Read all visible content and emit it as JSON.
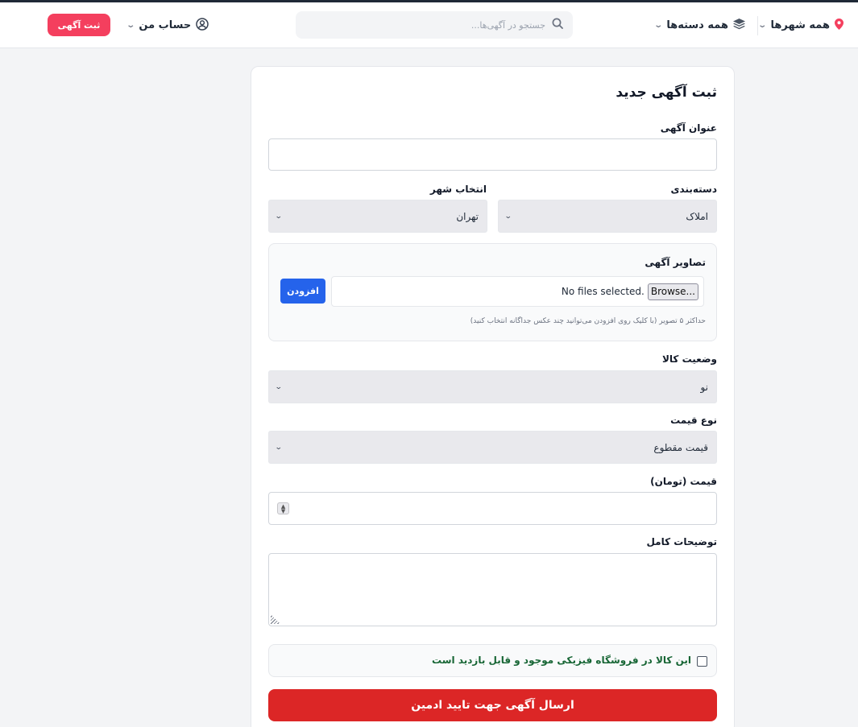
{
  "header": {
    "city_label": "همه شهرها",
    "categories_label": "همه دسته‌ها",
    "search_placeholder": "جستجو در آگهی‌ها...",
    "account_label": "حساب من",
    "post_ad_label": "ثبت آگهی",
    "accent_color": "#f43f5e"
  },
  "form": {
    "title": "ثبت آگهی جدید",
    "ad_title_label": "عنوان آگهی",
    "ad_title_value": "",
    "category_label": "دسته‌بندی",
    "category_value": "املاک",
    "city_label": "انتخاب شهر",
    "city_value": "تهران",
    "images_label": "تصاویر آگهی",
    "browse_label": "Browse...",
    "no_files_label": "No files selected.",
    "add_label": "افزودن",
    "images_hint": "حداکثر ۵ تصویر (با کلیک روی افزودن می‌توانید چند عکس جداگانه انتخاب کنید)",
    "condition_label": "وضعیت کالا",
    "condition_value": "نو",
    "price_type_label": "نوع قیمت",
    "price_type_value": "قیمت مقطوع",
    "price_label": "قیمت (تومان)",
    "price_value": "",
    "description_label": "توضیحات کامل",
    "description_value": "",
    "physical_store_label": "این کالا در فروشگاه فیزیکی موجود و قابل بازدید است",
    "physical_store_checked": false,
    "submit_label": "ارسال آگهی جهت تایید ادمین",
    "submit_color": "#dc2626",
    "add_color": "#2563eb"
  }
}
